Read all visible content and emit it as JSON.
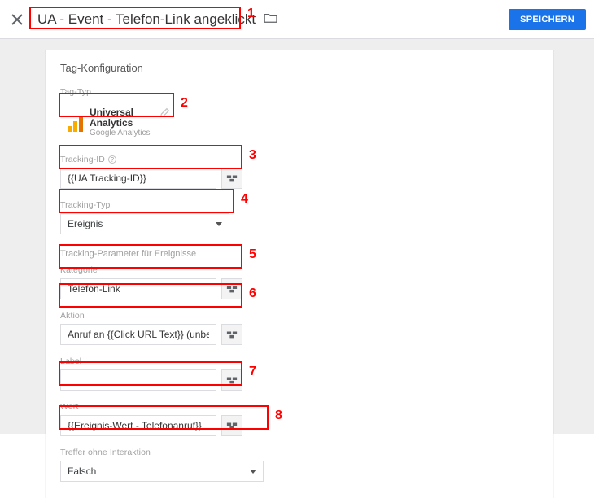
{
  "header": {
    "tag_title": "UA - Event - Telefon-Link angeklickt",
    "save_label": "SPEICHERN"
  },
  "panel": {
    "title": "Tag-Konfiguration",
    "tag_type_label": "Tag-Typ",
    "tag_type_name": "Universal Analytics",
    "tag_type_sub": "Google Analytics",
    "tracking_id_label": "Tracking-ID",
    "tracking_id_value": "{{UA Tracking-ID}}",
    "tracking_type_label": "Tracking-Typ",
    "tracking_type_value": "Ereignis",
    "event_params_heading": "Tracking-Parameter für Ereignisse",
    "category_label": "Kategorie",
    "category_value": "Telefon-Link",
    "action_label": "Aktion",
    "action_value": "Anruf an {{Click URL Text}} (unbestätigt)",
    "label_label": "Label",
    "label_value": "",
    "value_label": "Wert",
    "value_value": "{{Ereignis-Wert - Telefonanruf}}",
    "noninteraction_label": "Treffer ohne Interaktion",
    "noninteraction_value": "Falsch"
  },
  "annotations": {
    "n1": "1",
    "n2": "2",
    "n3": "3",
    "n4": "4",
    "n5": "5",
    "n6": "6",
    "n7": "7",
    "n8": "8"
  }
}
